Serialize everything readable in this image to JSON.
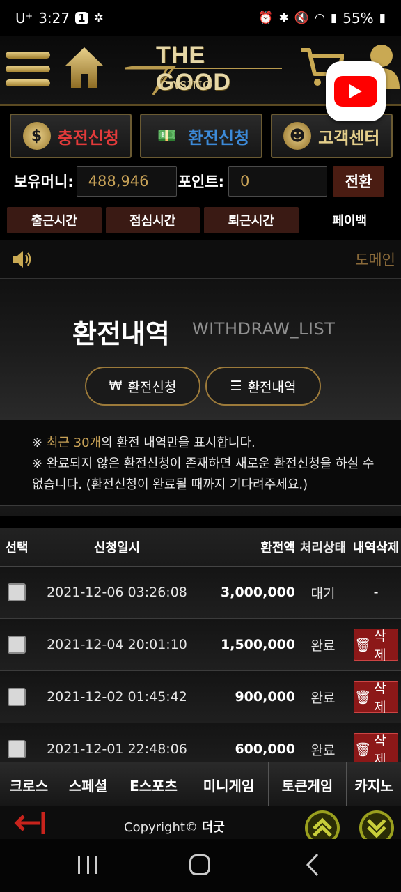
{
  "status_bar": {
    "carrier": "U⁺",
    "time": "3:27",
    "notif_count": "1",
    "battery": "55%"
  },
  "header": {
    "logo_main": "THE GOOD",
    "logo_sub": "CASINO"
  },
  "actions": {
    "deposit": "충전신청",
    "withdraw": "환전신청",
    "support": "고객센터"
  },
  "money": {
    "balance_label": "보유머니:",
    "balance_value": "488,946",
    "point_label": "포인트:",
    "point_value": "0",
    "convert": "전환"
  },
  "time_tabs": [
    "출근시간",
    "점심시간",
    "퇴근시간",
    "페이백"
  ],
  "marquee": {
    "text": "도메인"
  },
  "hero": {
    "title": "환전내역",
    "subtitle": "WITHDRAW_LIST",
    "pill_apply": "환전신청",
    "pill_list": "환전내역",
    "notice_prefix": "※ ",
    "notice_highlight": "최근 30개",
    "notice_line1_rest": "의 환전 내역만을 표시합니다.",
    "notice_line2": "※ 완료되지 않은 환전신청이 존재하면 새로운 환전신청을 하실 수 없습니다. (환전신청이 완료될 때까지 기다려주세요.)"
  },
  "table": {
    "headers": [
      "선택",
      "신청일시",
      "환전액",
      "처리상태",
      "내역삭제"
    ],
    "rows": [
      {
        "date": "2021-12-06 03:26:08",
        "amount": "3,000,000",
        "status": "대기",
        "delete": "-"
      },
      {
        "date": "2021-12-04 20:01:10",
        "amount": "1,500,000",
        "status": "완료",
        "delete": "삭제"
      },
      {
        "date": "2021-12-02 01:45:42",
        "amount": "900,000",
        "status": "완료",
        "delete": "삭제"
      },
      {
        "date": "2021-12-01 22:48:06",
        "amount": "600,000",
        "status": "완료",
        "delete": "삭제"
      }
    ]
  },
  "game_nav": [
    "크로스",
    "스페셜",
    "E스포츠",
    "미니게임",
    "토큰게임",
    "카지노"
  ],
  "footer": {
    "copyright": "Copyright©",
    "brand": "더굿"
  },
  "colors": {
    "gold": "#c8a257",
    "deposit_red": "#e23a3a",
    "withdraw_blue": "#3c8ad8",
    "delete_red": "#8c1818"
  }
}
